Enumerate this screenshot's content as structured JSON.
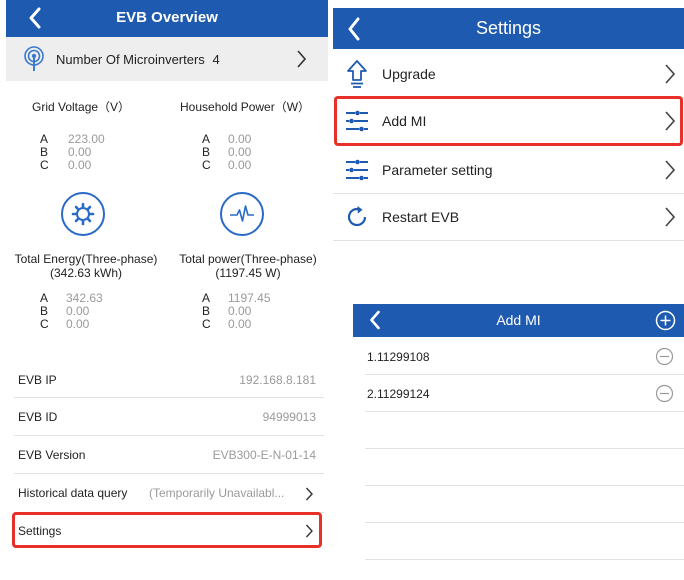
{
  "left": {
    "title": "EVB Overview",
    "micro_label": "Number Of Microinverters",
    "micro_count": "4",
    "grid_title": "Grid Voltage（V）",
    "grid_values": [
      {
        "phase": "A",
        "value": "223.00"
      },
      {
        "phase": "B",
        "value": "0.00"
      },
      {
        "phase": "C",
        "value": "0.00"
      }
    ],
    "house_title": "Household Power（W）",
    "house_values": [
      {
        "phase": "A",
        "value": "0.00"
      },
      {
        "phase": "B",
        "value": "0.00"
      },
      {
        "phase": "C",
        "value": "0.00"
      }
    ],
    "energy_title": "Total Energy(Three-phase)",
    "energy_total": "(342.63 kWh)",
    "energy_values": [
      {
        "phase": "A",
        "value": "342.63"
      },
      {
        "phase": "B",
        "value": "0.00"
      },
      {
        "phase": "C",
        "value": "0.00"
      }
    ],
    "power_title": "Total power(Three-phase)",
    "power_total": "(1197.45 W)",
    "power_values": [
      {
        "phase": "A",
        "value": "1197.45"
      },
      {
        "phase": "B",
        "value": "0.00"
      },
      {
        "phase": "C",
        "value": "0.00"
      }
    ],
    "info": [
      {
        "label": "EVB IP",
        "value": "192.168.8.181"
      },
      {
        "label": "EVB ID",
        "value": "94999013"
      },
      {
        "label": "EVB Version",
        "value": "EVB300-E-N-01-14"
      }
    ],
    "history_label": "Historical data query",
    "history_value": "(Temporarily Unavailabl...",
    "settings_label": "Settings"
  },
  "settings": {
    "title": "Settings",
    "items": [
      {
        "label": "Upgrade",
        "icon": "upgrade-arrow-icon"
      },
      {
        "label": "Add MI",
        "icon": "sliders-icon"
      },
      {
        "label": "Parameter setting",
        "icon": "sliders-icon"
      },
      {
        "label": "Restart EVB",
        "icon": "restart-icon"
      }
    ]
  },
  "addmi": {
    "title": "Add MI",
    "items": [
      {
        "label": "1.11299108"
      },
      {
        "label": "2.11299124"
      }
    ]
  },
  "colors": {
    "header": "#1e5bb0",
    "highlight": "#e8302a",
    "icon_blue": "#1e5bb0"
  }
}
